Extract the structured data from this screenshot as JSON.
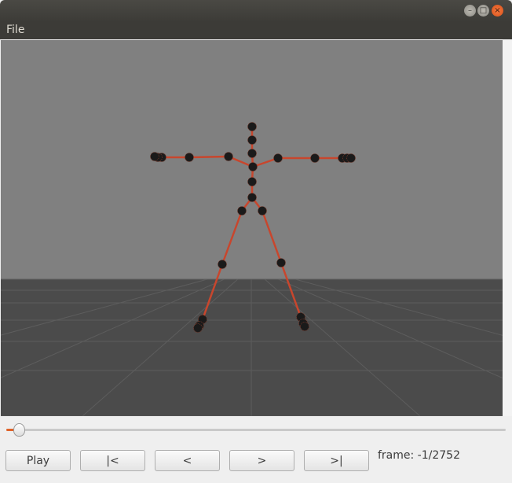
{
  "window": {
    "controls": {
      "minimize_icon": "–",
      "maximize_icon": "□",
      "close_icon": "×"
    }
  },
  "menu": {
    "items": [
      {
        "label": "File"
      }
    ]
  },
  "viewer": {
    "sky_color": "#808080",
    "floor_color": "#4b4b4b",
    "bone_color": "#c8462d",
    "joint_color": "#1a1a1a"
  },
  "timeline": {
    "progress": 0.0
  },
  "controls": {
    "play_label": "Play",
    "first_label": "|<",
    "prev_label": "<",
    "next_label": ">",
    "last_label": ">|"
  },
  "status": {
    "frame_text": "frame: -1/2752"
  }
}
